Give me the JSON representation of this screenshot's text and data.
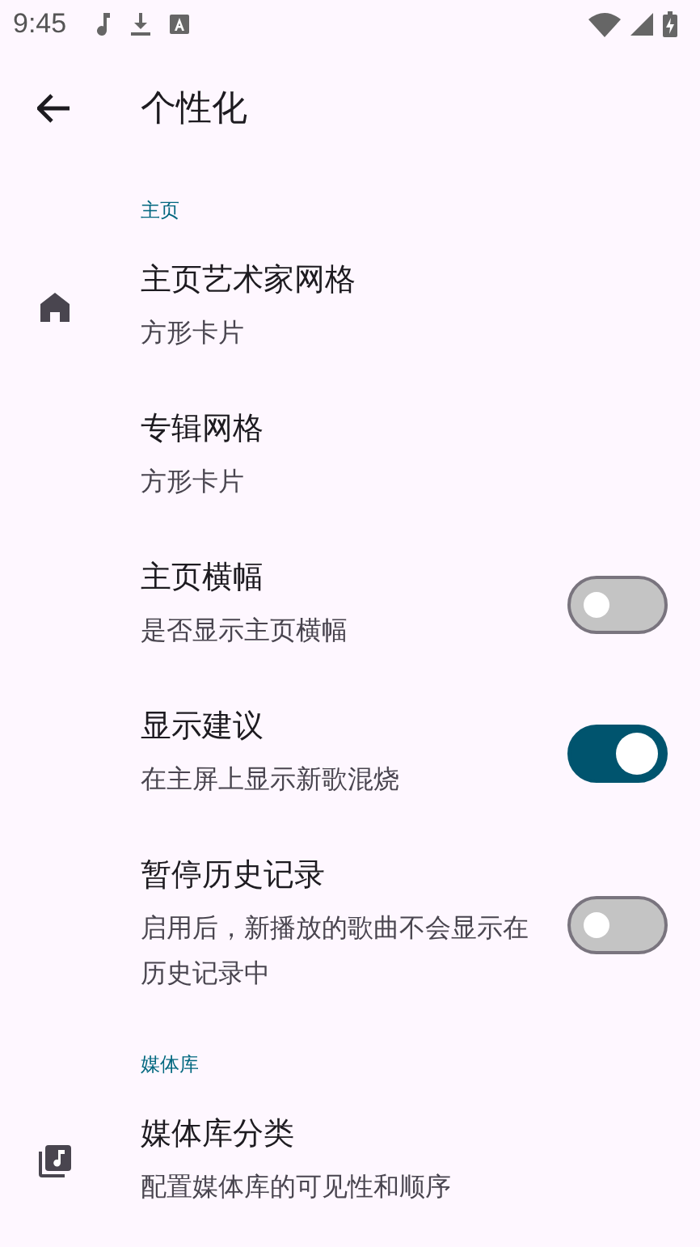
{
  "status_bar": {
    "time": "9:45"
  },
  "app_bar": {
    "title": "个性化"
  },
  "sections": [
    {
      "header": "主页",
      "items": [
        {
          "kind": "link",
          "leading_icon": true,
          "title": "主页艺术家网格",
          "subtitle": "方形卡片"
        },
        {
          "kind": "link",
          "leading_icon": false,
          "title": "专辑网格",
          "subtitle": "方形卡片"
        },
        {
          "kind": "switch",
          "leading_icon": false,
          "title": "主页横幅",
          "subtitle": "是否显示主页横幅",
          "on": false
        },
        {
          "kind": "switch",
          "leading_icon": false,
          "title": "显示建议",
          "subtitle": "在主屏上显示新歌混烧",
          "on": true
        },
        {
          "kind": "switch",
          "leading_icon": false,
          "title": "暂停历史记录",
          "subtitle": "启用后，新播放的歌曲不会显示在历史记录中",
          "on": false
        }
      ]
    },
    {
      "header": "媒体库",
      "items": [
        {
          "kind": "link",
          "leading_icon": true,
          "title": "媒体库分类",
          "subtitle": "配置媒体库的可见性和顺序"
        }
      ]
    }
  ]
}
